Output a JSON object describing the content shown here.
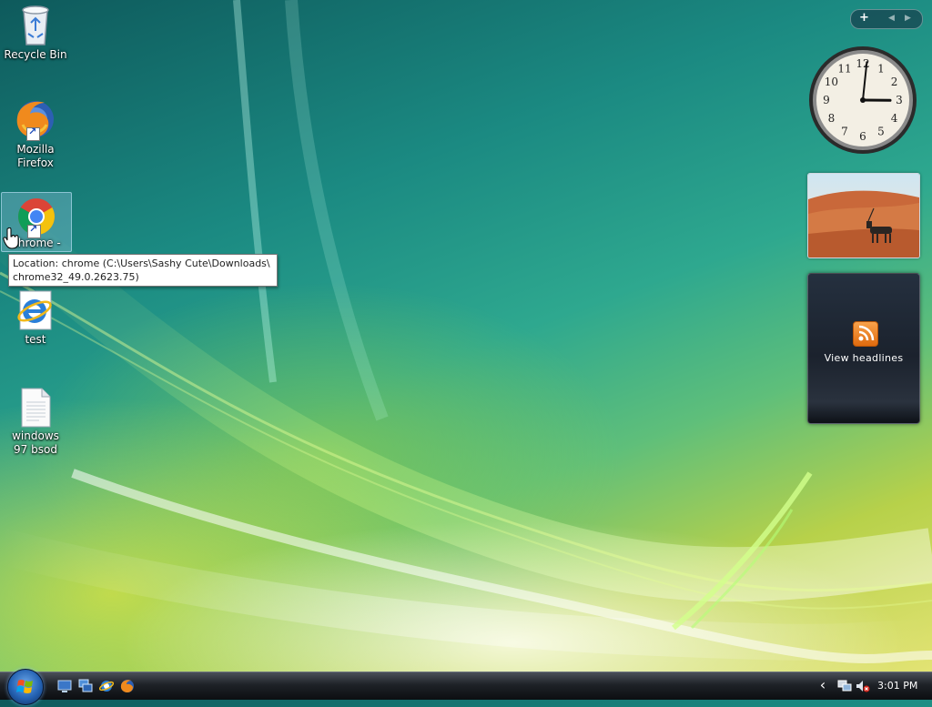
{
  "desktop": {
    "icons": [
      {
        "label": "Recycle Bin",
        "icon": "recycle-bin-icon"
      },
      {
        "label": "Mozilla Firefox",
        "icon": "firefox-icon"
      },
      {
        "label": "chrome -",
        "icon": "chrome-icon"
      },
      {
        "label": "test",
        "icon": "internet-explorer-icon"
      },
      {
        "label": "windows 97 bsod",
        "icon": "text-document-icon"
      }
    ],
    "tooltip": {
      "line1": "Location: chrome (C:\\Users\\Sashy Cute\\Downloads\\",
      "line2": "chrome32_49.0.2623.75)"
    }
  },
  "sidebar": {
    "controls": {
      "add": "+",
      "prev": "◀",
      "next": "▶"
    },
    "clock": {
      "time": "3:01",
      "numerals": [
        "12",
        "1",
        "2",
        "3",
        "4",
        "5",
        "6",
        "7",
        "8",
        "9",
        "10",
        "11"
      ]
    },
    "slideshow": {
      "subject": "oryx in desert dunes"
    },
    "feed": {
      "label": "View headlines",
      "icon": "rss-icon"
    }
  },
  "taskbar": {
    "start_icon": "windows-orb-icon",
    "quick_launch": [
      "show-desktop-icon",
      "switch-windows-icon",
      "internet-explorer-icon",
      "firefox-icon"
    ],
    "tray": {
      "expand": "‹",
      "icons": [
        "network-icon",
        "volume-muted-icon"
      ],
      "time": "3:01 PM"
    }
  },
  "colors": {
    "wallpaper_dark": "#0e5a5c",
    "wallpaper_light": "#e9e67a",
    "taskbar": "#1e2227",
    "selection": "#b4dcff"
  }
}
